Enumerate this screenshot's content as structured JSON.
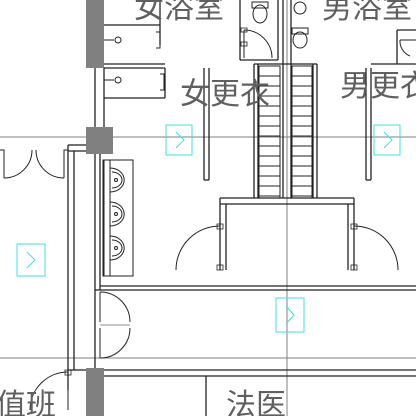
{
  "plan": {
    "labels": {
      "women_shower": "女浴室",
      "men_shower": "男浴室",
      "women_changing": "女更衣",
      "men_changing": "男更衣",
      "duty_room": "值班",
      "forensic": "法医"
    },
    "colors": {
      "wall": "#222222",
      "column": "#808080",
      "axis": "#808080",
      "symbol": "#40e0e0",
      "text": "#5f5f5f"
    }
  }
}
